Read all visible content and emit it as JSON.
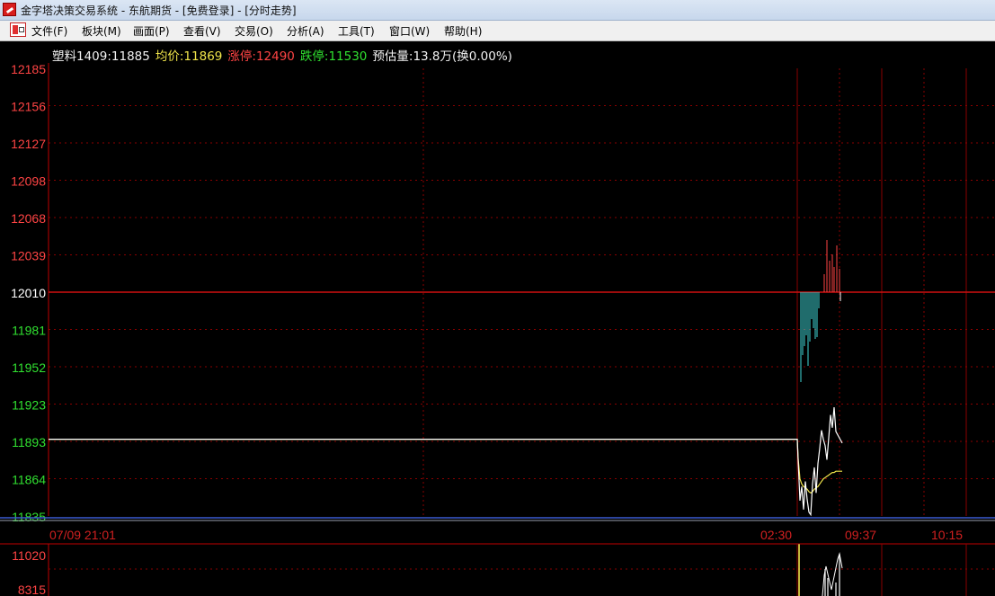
{
  "window": {
    "title": "金字塔决策交易系统 - 东航期货 - [免费登录] - [分时走势]"
  },
  "menu": [
    {
      "label": "文件(F)"
    },
    {
      "label": "板块(M)"
    },
    {
      "label": "画面(P)"
    },
    {
      "label": "查看(V)"
    },
    {
      "label": "交易(O)"
    },
    {
      "label": "分析(A)"
    },
    {
      "label": "工具(T)"
    },
    {
      "label": "窗口(W)"
    },
    {
      "label": "帮助(H)"
    }
  ],
  "quote": {
    "symbol_price": "塑料1409:11885",
    "avg_label": "均价:",
    "avg_value": "11869",
    "limit_up_label": "涨停:",
    "limit_up_value": "12490",
    "limit_down_label": "跌停:",
    "limit_down_value": "11530",
    "volume_text": "预估量:13.8万(换0.00%)"
  },
  "colors": {
    "up": "#ff4444",
    "down": "#30e030",
    "price_line": "#ffffff",
    "avg_line": "#f0e44a",
    "grid": "#8a0000",
    "axis": "#c00000",
    "volume_down": "#40d8d8",
    "background": "#000000"
  },
  "chart_data": {
    "type": "line",
    "y_axis_labels": [
      "12185",
      "12156",
      "12127",
      "12098",
      "12068",
      "12039",
      "12010",
      "11981",
      "11952",
      "11923",
      "11893",
      "11864",
      "11835"
    ],
    "ylim": [
      11835,
      12185
    ],
    "reference_price": 12010,
    "x_labels": [
      "07/09 21:01",
      "02:30",
      "09:37",
      "10:15"
    ],
    "series": [
      {
        "values": [
          11895,
          11895,
          11895,
          11895,
          11878,
          11847,
          11858,
          11840,
          11862,
          11848,
          11838,
          11836,
          11860,
          11873,
          11853,
          11876,
          11888,
          11902,
          11895,
          11890,
          11879,
          11896,
          11914,
          11904,
          11920,
          11901,
          11892
        ]
      },
      {
        "values": [
          11895,
          11895,
          11895,
          11895,
          11880,
          11864,
          11860,
          11858,
          11857,
          11856,
          11854,
          11853,
          11854,
          11856,
          11857,
          11858,
          11860,
          11862,
          11864,
          11865,
          11866,
          11867,
          11868,
          11869,
          11869,
          11870,
          11870
        ]
      }
    ],
    "volume_axis_labels": [
      "11020",
      "8315"
    ]
  }
}
